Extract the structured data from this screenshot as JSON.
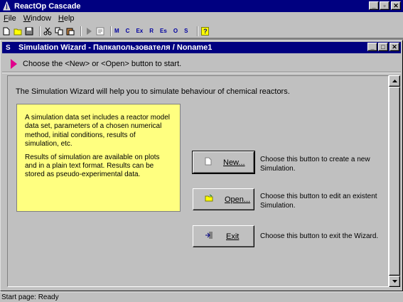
{
  "app": {
    "title": "ReactOp Cascade",
    "controls": {
      "minimize": "_",
      "restore": "▫",
      "close": "✕"
    }
  },
  "menu": {
    "items": [
      {
        "label": "File",
        "hotkey": "F",
        "rest": "ile"
      },
      {
        "label": "Window",
        "hotkey": "W",
        "rest": "indow"
      },
      {
        "label": "Help",
        "hotkey": "H",
        "rest": "elp"
      }
    ]
  },
  "toolbar": {
    "text_buttons": [
      "M",
      "C",
      "Ex",
      "R",
      "Es",
      "O",
      "S"
    ],
    "help": "?"
  },
  "wizard": {
    "title": "Simulation Wizard - Папкапользователя / Noname1",
    "title_icon": "S",
    "hint": "Choose the <New> or <Open> button to start.",
    "intro": "The Simulation Wizard will help you to simulate behaviour of chemical reactors.",
    "note": [
      "A simulation data set includes a reactor model data set, parameters of a chosen numerical method, initial conditions, results of simulation, etc.",
      "Results of simulation are available on plots and in a plain text format.  Results can be stored as pseudo-experimental data."
    ],
    "buttons": {
      "new": {
        "label": "New...",
        "desc": "Choose this button to create a new Simulation."
      },
      "open": {
        "label": "Open...",
        "desc": "Choose this button to edit an existent Simulation."
      },
      "exit": {
        "label": "Exit",
        "desc": "Choose this button to exit the Wizard."
      }
    }
  },
  "status": {
    "text": "Start page:  Ready"
  },
  "colors": {
    "titlebar": "#000080",
    "face": "#c0c0c0",
    "note_bg": "#ffff80",
    "hint_arrow": "#e0008c"
  }
}
